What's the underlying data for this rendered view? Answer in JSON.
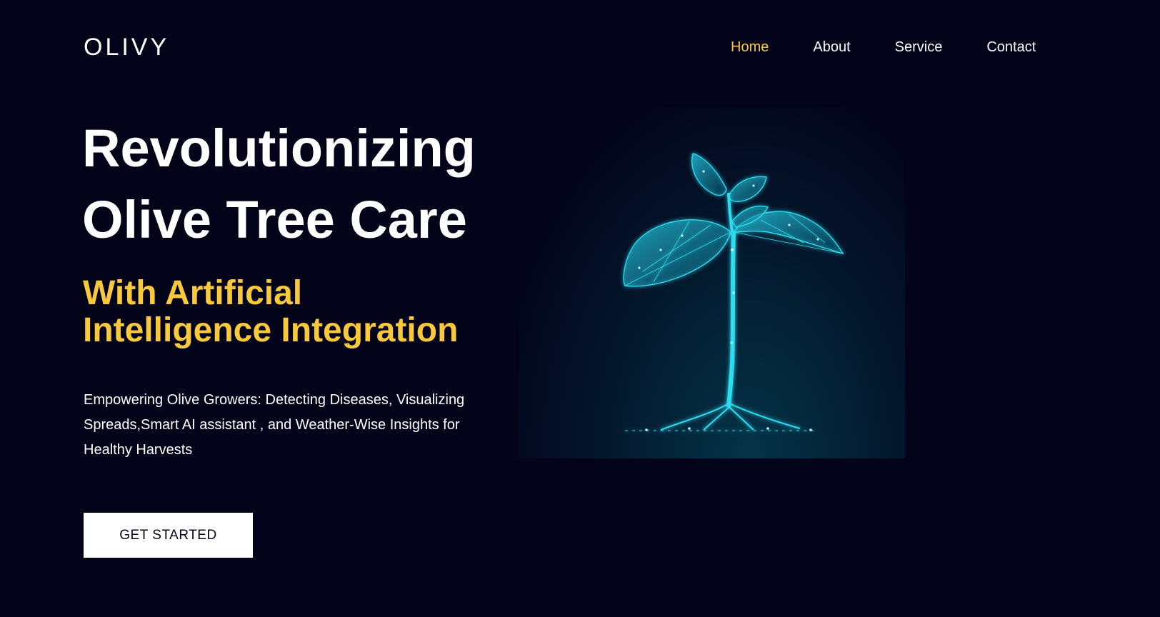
{
  "brand": {
    "logo": "OLIVY"
  },
  "nav": {
    "items": [
      {
        "label": "Home",
        "active": true
      },
      {
        "label": "About",
        "active": false
      },
      {
        "label": "Service",
        "active": false
      },
      {
        "label": "Contact",
        "active": false
      }
    ]
  },
  "hero": {
    "title_line1": "Revolutionizing",
    "title_line2": "Olive Tree Care",
    "subtitle_line1": "With Artificial",
    "subtitle_line2": "Intelligence Integration",
    "description": "Empowering Olive Growers: Detecting Diseases, Visualizing Spreads,Smart AI assistant , and Weather-Wise Insights for Healthy Harvests",
    "cta_label": "GET STARTED"
  },
  "illustration": {
    "icon": "seedling-icon"
  },
  "colors": {
    "background": "#03031a",
    "accent": "#f7c93b",
    "text": "#ffffff",
    "plant": "#22d3e6"
  }
}
